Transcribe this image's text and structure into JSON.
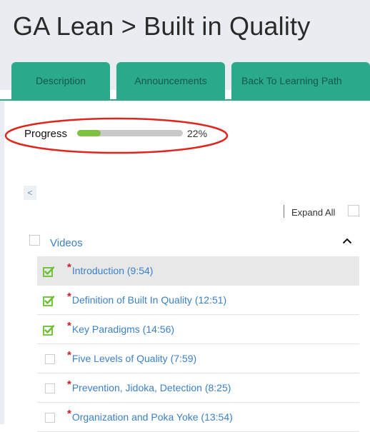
{
  "header": {
    "title": "GA Lean > Built in Quality"
  },
  "tabs": [
    {
      "label": "Description"
    },
    {
      "label": "Announcements"
    },
    {
      "label": "Back To Learning Path"
    }
  ],
  "progress": {
    "label": "Progress",
    "percent_text": "22%",
    "value": 0.22
  },
  "controls": {
    "back_label": "<",
    "expand_all_label": "Expand All"
  },
  "section": {
    "title": "Videos",
    "expanded": true
  },
  "lessons": [
    {
      "title": "Introduction (9:54)",
      "required": "*",
      "completed": true,
      "selected": true
    },
    {
      "title": "Definition of Built In Quality (12:51)",
      "required": "*",
      "completed": true,
      "selected": false
    },
    {
      "title": "Key Paradigms (14:56)",
      "required": "*",
      "completed": true,
      "selected": false
    },
    {
      "title": "Five Levels of Quality (7:59)",
      "required": "*",
      "completed": false,
      "selected": false
    },
    {
      "title": "Prevention, Jidoka, Detection (8:25)",
      "required": "*",
      "completed": false,
      "selected": false
    },
    {
      "title": "Organization and Poka Yoke (13:54)",
      "required": "*",
      "completed": false,
      "selected": false
    }
  ],
  "colors": {
    "tab": "#2aaa8a",
    "progress_fill": "#7fc041",
    "link": "#3b80c8",
    "annotation": "#e0251d",
    "required": "#c6202a"
  }
}
